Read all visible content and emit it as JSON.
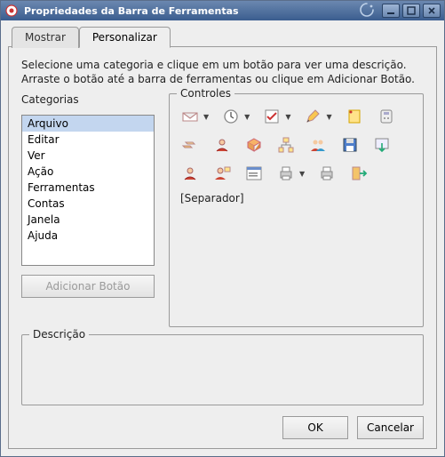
{
  "window": {
    "title": "Propriedades da Barra de Ferramentas"
  },
  "tabs": {
    "show": "Mostrar",
    "customize": "Personalizar"
  },
  "intro_line1": "Selecione uma categoria e clique em um botão para ver uma descrição.",
  "intro_line2": "Arraste o botão até a barra de ferramentas ou clique em Adicionar Botão.",
  "categories": {
    "label": "Categorias",
    "items": [
      "Arquivo",
      "Editar",
      "Ver",
      "Ação",
      "Ferramentas",
      "Contas",
      "Janela",
      "Ajuda"
    ],
    "selected_index": 0
  },
  "add_button_label": "Adicionar Botão",
  "controls": {
    "label": "Controles",
    "items": [
      {
        "name": "mail-icon",
        "has_dropdown": true
      },
      {
        "name": "clock-icon",
        "has_dropdown": true
      },
      {
        "name": "task-icon",
        "has_dropdown": true
      },
      {
        "name": "edit-icon",
        "has_dropdown": true
      },
      {
        "name": "note-icon",
        "has_dropdown": false
      },
      {
        "name": "phone-icon",
        "has_dropdown": false
      },
      {
        "name": "folders-icon",
        "has_dropdown": false
      },
      {
        "name": "user-red-icon",
        "has_dropdown": false
      },
      {
        "name": "cube-icon",
        "has_dropdown": false
      },
      {
        "name": "orgchart-icon",
        "has_dropdown": false
      },
      {
        "name": "user-group-icon",
        "has_dropdown": false
      },
      {
        "name": "save-icon",
        "has_dropdown": false
      },
      {
        "name": "import-icon",
        "has_dropdown": false
      },
      {
        "name": "user-icon",
        "has_dropdown": false
      },
      {
        "name": "user-add-icon",
        "has_dropdown": false
      },
      {
        "name": "window-list-icon",
        "has_dropdown": false
      },
      {
        "name": "print-icon",
        "has_dropdown": true
      },
      {
        "name": "print-setup-icon",
        "has_dropdown": false
      },
      {
        "name": "exit-icon",
        "has_dropdown": false
      },
      {
        "name": "separator",
        "has_dropdown": false,
        "text": "[Separador]"
      }
    ]
  },
  "description": {
    "label": "Descrição"
  },
  "footer": {
    "ok": "OK",
    "cancel": "Cancelar"
  }
}
